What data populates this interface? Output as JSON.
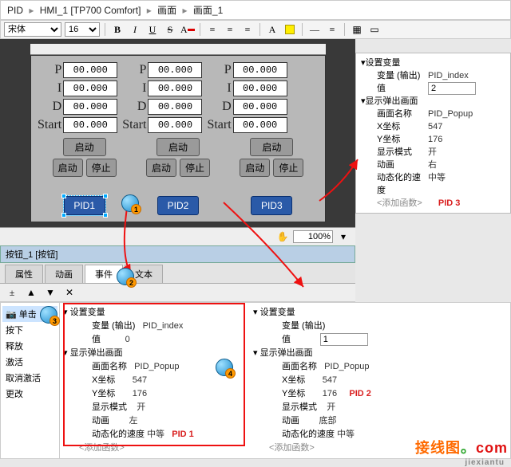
{
  "breadcrumb": {
    "root": "PID",
    "dev": "HMI_1 [TP700 Comfort]",
    "group": "画面",
    "screen": "画面_1"
  },
  "toolbar": {
    "font": "宋体",
    "size": "16",
    "bold": "B",
    "italic": "I",
    "underline": "U",
    "strike": "S"
  },
  "canvas": {
    "labels": {
      "P": "P",
      "I": "I",
      "D": "D",
      "start": "Start"
    },
    "numval": "00.000",
    "btn_run": "启动",
    "btn_start": "启动",
    "btn_stop": "停止",
    "pid_btn1": "PID1",
    "pid_btn2": "PID2",
    "pid_btn3": "PID3"
  },
  "zoom": "100%",
  "panel_title": "按钮_1 [按钮]",
  "tabs": {
    "props": "属性",
    "anim": "动画",
    "events": "事件",
    "text": "文本"
  },
  "events": {
    "click": "单击",
    "press": "按下",
    "release": "释放",
    "activate": "激活",
    "deactivate": "取消激活",
    "change": "更改"
  },
  "tree": {
    "set_var": "设置变量",
    "var_out": "变量 (输出)",
    "var_out_v1": "PID_index",
    "value": "值",
    "value_v0": "0",
    "popup": "显示弹出画面",
    "screen_name": "画面名称",
    "screen_name_v": "PID_Popup",
    "x": "X坐标",
    "x_v": "547",
    "y": "Y坐标",
    "y_v": "176",
    "mode": "显示模式",
    "mode_open": "开",
    "anim": "动画",
    "anim_left": "左",
    "anim_right": "右",
    "anim_bottom": "底部",
    "speed": "动态化的速度",
    "speed_v": "中等",
    "add_fn": "<添加函数>",
    "tag1": "PID 1",
    "tag2": "PID 2",
    "tag3": "PID 3"
  },
  "right": {
    "value_input3": "2",
    "value_input2": "1"
  }
}
